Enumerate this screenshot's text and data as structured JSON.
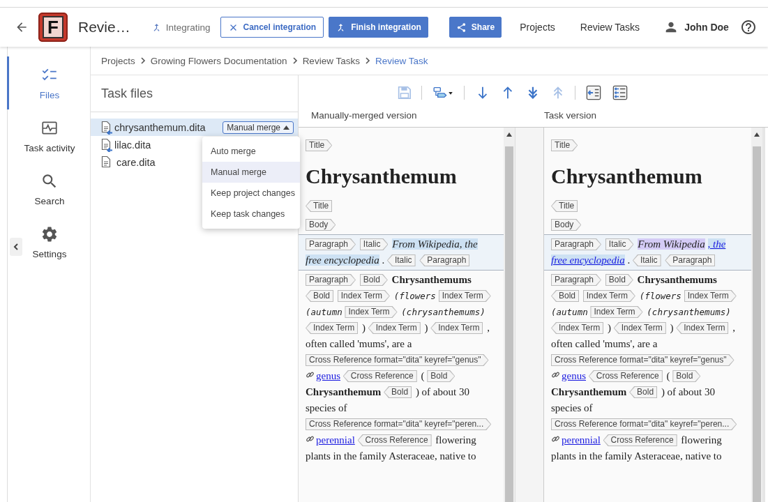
{
  "app": {
    "logo_letter": "F",
    "title": "Revie…"
  },
  "status": {
    "label": "Integrating"
  },
  "actions": [
    {
      "kind": "outline",
      "label": "Cancel integration"
    },
    {
      "kind": "primary",
      "label": "Finish integration"
    },
    {
      "kind": "share",
      "label": "Share"
    }
  ],
  "nav_links": [
    "Projects",
    "Review Tasks"
  ],
  "user": {
    "name": "John Doe"
  },
  "sidebar": {
    "items": [
      {
        "label": "Files",
        "selected": true
      },
      {
        "label": "Task activity",
        "selected": false
      },
      {
        "label": "Search",
        "selected": false
      },
      {
        "label": "Settings",
        "selected": false
      }
    ]
  },
  "breadcrumb": [
    {
      "label": "Projects",
      "selected": false
    },
    {
      "label": "Growing Flowers Documentation",
      "selected": false
    },
    {
      "label": "Review Tasks",
      "selected": false
    },
    {
      "label": "Review Task",
      "selected": true
    }
  ],
  "task_files": {
    "title": "Task files",
    "files": [
      {
        "name": "chrysanthemum.dita",
        "changed": true,
        "selected": true,
        "merge_mode": "Manual merge"
      },
      {
        "name": "lilac.dita",
        "changed": true,
        "selected": false
      },
      {
        "name": "care.dita",
        "changed": false,
        "selected": false
      }
    ]
  },
  "merge_menu": {
    "items": [
      {
        "label": "Auto merge",
        "selected": false
      },
      {
        "label": "Manual merge",
        "selected": true
      },
      {
        "label": "Keep project changes",
        "selected": false
      },
      {
        "label": "Keep task changes",
        "selected": false
      }
    ]
  },
  "editor": {
    "toolbar": [
      {
        "kind": "save",
        "disabled": true
      },
      {
        "kind": "merge-options",
        "disabled": false
      },
      {
        "kind": "next",
        "disabled": false
      },
      {
        "kind": "previous",
        "disabled": false
      },
      {
        "kind": "next-conflict",
        "disabled": false
      },
      {
        "kind": "previous-conflict",
        "disabled": true
      },
      {
        "kind": "copy-change",
        "disabled": false
      },
      {
        "kind": "copy-all",
        "disabled": false
      }
    ],
    "panes": [
      {
        "title": "Manually-merged version",
        "blocks": [
          {
            "highlighted": false,
            "tokens": [
              {
                "kind": "open",
                "text": "Title"
              }
            ]
          },
          {
            "highlighted": false,
            "tokens": [
              {
                "kind": "heading",
                "text": "Chrysanthemum"
              }
            ]
          },
          {
            "highlighted": false,
            "tokens": [
              {
                "kind": "close",
                "text": "Title"
              }
            ]
          },
          {
            "highlighted": false,
            "tokens": [
              {
                "kind": "open",
                "text": "Body"
              }
            ]
          },
          {
            "highlighted": true,
            "tokens": [
              {
                "kind": "open",
                "text": "Paragraph"
              },
              {
                "kind": "open",
                "text": "Italic"
              },
              {
                "kind": "italic",
                "color": "#cde1f3",
                "text": "From Wikipedia, the"
              },
              {
                "kind": "italic",
                "color": "#cde1f3",
                "text": "free encyclopedia"
              },
              {
                "kind": "plain",
                "text": "."
              },
              {
                "kind": "close",
                "text": "Italic"
              },
              {
                "kind": "close",
                "text": "Paragraph"
              }
            ]
          },
          {
            "highlighted": false,
            "tokens": [
              {
                "kind": "open",
                "text": "Paragraph"
              },
              {
                "kind": "open",
                "text": "Bold"
              },
              {
                "kind": "bold",
                "text": "Chrysanthemums"
              },
              {
                "kind": "close",
                "text": "Bold"
              },
              {
                "kind": "open",
                "text": "Index Term"
              },
              {
                "kind": "mono",
                "text": "(flowers"
              },
              {
                "kind": "open",
                "text": "Index Term"
              },
              {
                "kind": "mono",
                "text": "(autumn"
              },
              {
                "kind": "open",
                "text": "Index Term"
              },
              {
                "kind": "mono",
                "text": "(chrysanthemums)"
              },
              {
                "kind": "close",
                "text": "Index Term"
              },
              {
                "kind": "plain",
                "text": ")"
              },
              {
                "kind": "close",
                "text": "Index Term"
              },
              {
                "kind": "plain",
                "text": ")"
              },
              {
                "kind": "close",
                "text": "Index Term"
              },
              {
                "kind": "plain",
                "text": ","
              },
              {
                "kind": "plain",
                "text": "often called 'mums', are a"
              },
              {
                "kind": "open",
                "text": "Cross Reference format=\"dita\" keyref=\"genus\""
              },
              {
                "kind": "link",
                "text": "genus"
              },
              {
                "kind": "close",
                "text": "Cross Reference"
              },
              {
                "kind": "plain",
                "text": "("
              },
              {
                "kind": "open",
                "text": "Bold"
              },
              {
                "kind": "bold",
                "text": "Chrysanthemum"
              },
              {
                "kind": "close",
                "text": "Bold"
              },
              {
                "kind": "plain",
                "text": ") of about 30"
              },
              {
                "kind": "plain",
                "text": "species of"
              },
              {
                "kind": "open",
                "text": "Cross Reference format=\"dita\" keyref=\"peren..."
              },
              {
                "kind": "link",
                "text": "perennial"
              },
              {
                "kind": "close",
                "text": "Cross Reference"
              },
              {
                "kind": "plain",
                "text": "flowering"
              },
              {
                "kind": "plain",
                "text": "plants in the family Asteraceae, native to"
              }
            ]
          }
        ]
      },
      {
        "title": "Task version",
        "blocks": [
          {
            "highlighted": false,
            "tokens": [
              {
                "kind": "open",
                "text": "Title"
              }
            ]
          },
          {
            "highlighted": false,
            "tokens": [
              {
                "kind": "heading",
                "text": "Chrysanthemum"
              }
            ]
          },
          {
            "highlighted": false,
            "tokens": [
              {
                "kind": "close",
                "text": "Title"
              }
            ]
          },
          {
            "highlighted": false,
            "tokens": [
              {
                "kind": "open",
                "text": "Body"
              }
            ]
          },
          {
            "highlighted": true,
            "tokens": [
              {
                "kind": "open",
                "text": "Paragraph"
              },
              {
                "kind": "open",
                "text": "Italic"
              },
              {
                "kind": "italic",
                "color": "#d4cbf5",
                "text": "From Wikipedia"
              },
              {
                "kind": "italic-link",
                "color": "#cde1f3",
                "text": ", the"
              },
              {
                "kind": "italic-link",
                "color": "#cde1f3",
                "text": "free encyclopedia"
              },
              {
                "kind": "plain",
                "text": "."
              },
              {
                "kind": "close",
                "text": "Italic"
              },
              {
                "kind": "close",
                "text": "Paragraph"
              }
            ]
          },
          {
            "highlighted": false,
            "tokens": [
              {
                "kind": "open",
                "text": "Paragraph"
              },
              {
                "kind": "open",
                "text": "Bold"
              },
              {
                "kind": "bold",
                "text": "Chrysanthemums"
              },
              {
                "kind": "close",
                "text": "Bold"
              },
              {
                "kind": "open",
                "text": "Index Term"
              },
              {
                "kind": "mono",
                "text": "(flowers"
              },
              {
                "kind": "open",
                "text": "Index Term"
              },
              {
                "kind": "mono",
                "text": "(autumn"
              },
              {
                "kind": "open",
                "text": "Index Term"
              },
              {
                "kind": "mono",
                "text": "(chrysanthemums)"
              },
              {
                "kind": "close",
                "text": "Index Term"
              },
              {
                "kind": "plain",
                "text": ")"
              },
              {
                "kind": "close",
                "text": "Index Term"
              },
              {
                "kind": "plain",
                "text": ")"
              },
              {
                "kind": "close",
                "text": "Index Term"
              },
              {
                "kind": "plain",
                "text": ","
              },
              {
                "kind": "plain",
                "text": "often called 'mums', are a"
              },
              {
                "kind": "open",
                "text": "Cross Reference format=\"dita\" keyref=\"genus\""
              },
              {
                "kind": "link",
                "text": "genus"
              },
              {
                "kind": "close",
                "text": "Cross Reference"
              },
              {
                "kind": "plain",
                "text": "("
              },
              {
                "kind": "open",
                "text": "Bold"
              },
              {
                "kind": "bold",
                "text": "Chrysanthemum"
              },
              {
                "kind": "close",
                "text": "Bold"
              },
              {
                "kind": "plain",
                "text": ") of about 30"
              },
              {
                "kind": "plain",
                "text": "species of"
              },
              {
                "kind": "open",
                "text": "Cross Reference format=\"dita\" keyref=\"peren..."
              },
              {
                "kind": "link",
                "text": "perennial"
              },
              {
                "kind": "close",
                "text": "Cross Reference"
              },
              {
                "kind": "plain",
                "text": "flowering"
              },
              {
                "kind": "plain",
                "text": "plants in the family Asteraceae, native to"
              }
            ]
          }
        ]
      }
    ]
  }
}
